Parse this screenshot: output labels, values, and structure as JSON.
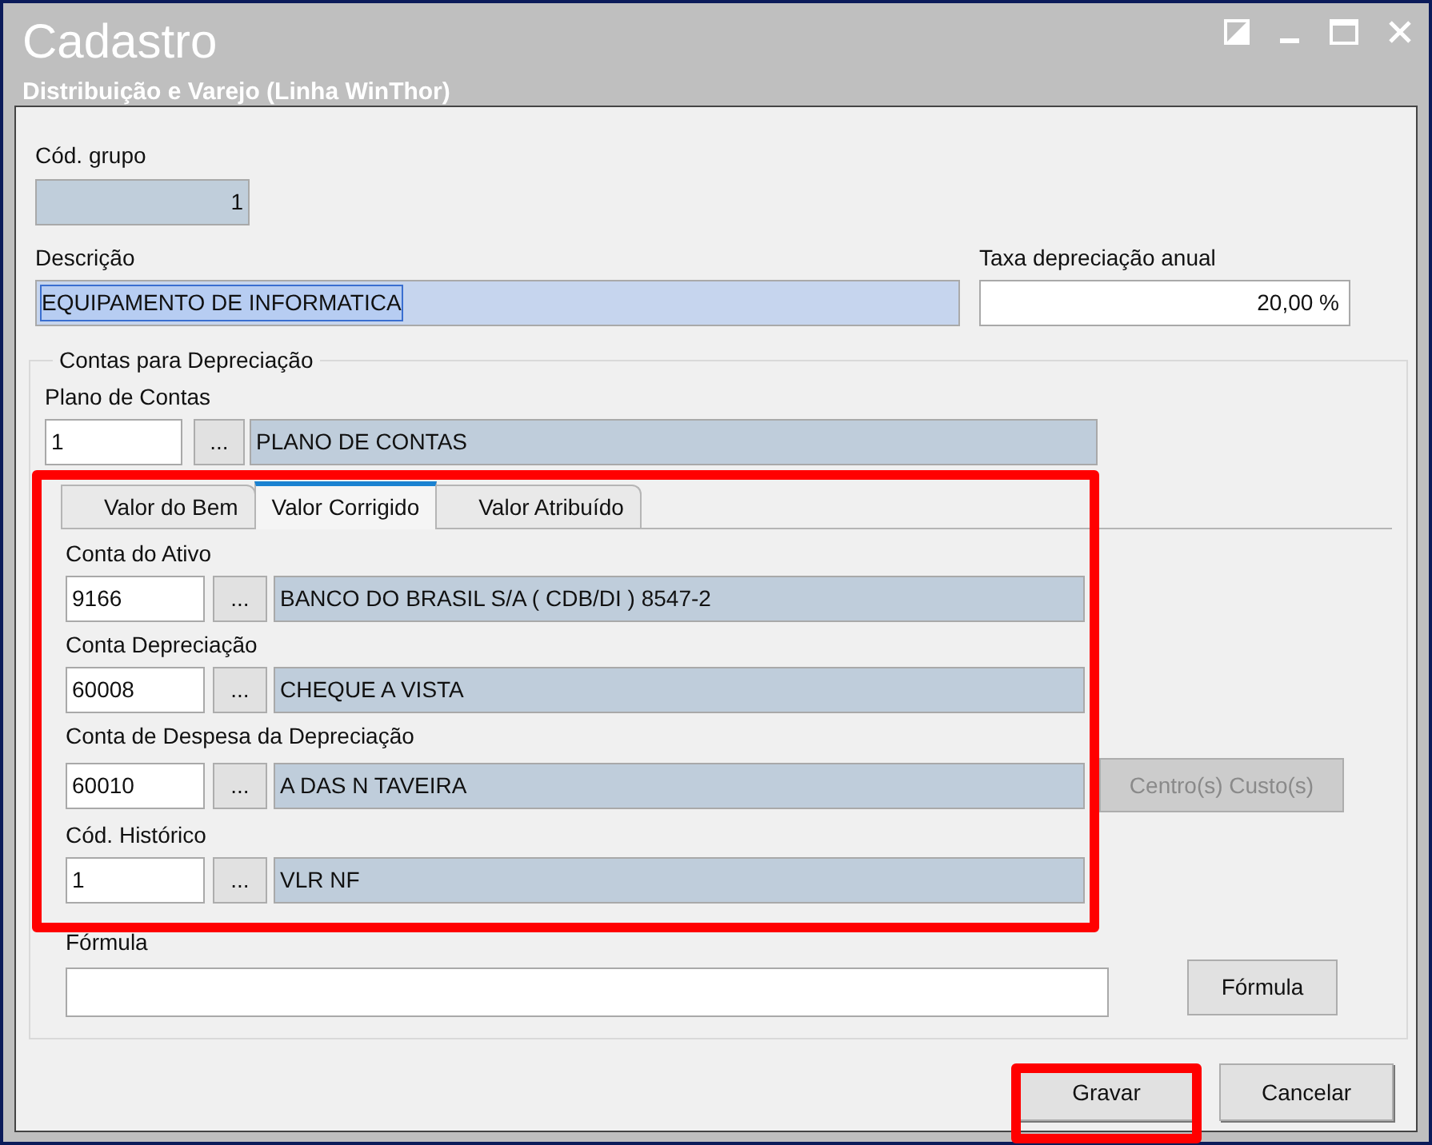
{
  "window": {
    "title": "Cadastro",
    "subtitle": "Distribuição e Varejo (Linha WinThor)"
  },
  "group_code": {
    "label": "Cód. grupo",
    "value": "1"
  },
  "description": {
    "label": "Descrição",
    "value": "EQUIPAMENTO DE INFORMATICA",
    "selected": true
  },
  "rate": {
    "label": "Taxa depreciação anual",
    "value": "20,00 %"
  },
  "accounts_group": {
    "legend": "Contas para Depreciação",
    "chart_of_accounts": {
      "label": "Plano de Contas",
      "code": "1",
      "lookup_button": "...",
      "name": "PLANO DE CONTAS"
    },
    "highlighted": true,
    "tabs": [
      {
        "label": "Valor do Bem",
        "selected": false
      },
      {
        "label": "Valor Corrigido",
        "selected": true
      },
      {
        "label": "Valor Atribuído",
        "selected": false
      }
    ],
    "rows": [
      {
        "label": "Conta do Ativo",
        "code": "9166",
        "lookup_button": "...",
        "name": "BANCO DO BRASIL S/A ( CDB/DI ) 8547-2"
      },
      {
        "label": "Conta Depreciação",
        "code": "60008",
        "lookup_button": "...",
        "name": "CHEQUE A VISTA"
      },
      {
        "label": "Conta de Despesa da Depreciação",
        "code": "60010",
        "lookup_button": "...",
        "name": "A DAS N TAVEIRA",
        "side_button": {
          "label": "Centro(s) Custo(s)",
          "disabled": true
        }
      },
      {
        "label": "Cód. Histórico",
        "code": "1",
        "lookup_button": "...",
        "name": "VLR NF"
      }
    ],
    "formula": {
      "label": "Fórmula",
      "button": "Fórmula"
    }
  },
  "buttons": [
    {
      "label": "Gravar",
      "highlighted": true
    },
    {
      "label": "Cancelar",
      "highlighted": false
    }
  ]
}
